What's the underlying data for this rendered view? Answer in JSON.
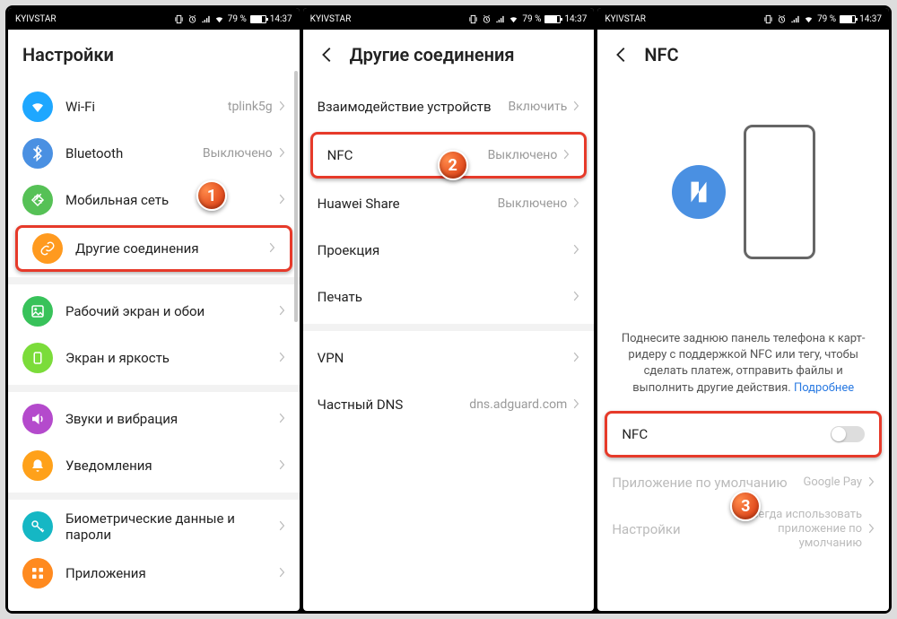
{
  "status": {
    "carrier": "KYIVSTAR",
    "battery": "79 %",
    "time": "14:37"
  },
  "s1": {
    "title": "Настройки",
    "rows": [
      {
        "label": "Wi-Fi",
        "value": "tplink5g",
        "icon": "wifi",
        "color": "#1ea7ff"
      },
      {
        "label": "Bluetooth",
        "value": "Выключено",
        "icon": "bt",
        "color": "#4a90e2"
      },
      {
        "label": "Мобильная сеть",
        "value": "",
        "icon": "sim",
        "color": "#56c156"
      },
      {
        "label": "Другие соединения",
        "value": "",
        "icon": "link",
        "color": "#ff9a1f",
        "hl": true
      },
      {
        "label": "Рабочий экран и обои",
        "value": "",
        "icon": "image",
        "color": "#38c25a"
      },
      {
        "label": "Экран и яркость",
        "value": "",
        "icon": "bright",
        "color": "#7bdc3a"
      },
      {
        "label": "Звуки и вибрация",
        "value": "",
        "icon": "sound",
        "color": "#b44acc"
      },
      {
        "label": "Уведомления",
        "value": "",
        "icon": "bell",
        "color": "#ffa11a"
      },
      {
        "label": "Биометрические данные и пароли",
        "value": "",
        "icon": "key",
        "color": "#15b7c4"
      },
      {
        "label": "Приложения",
        "value": "",
        "icon": "apps",
        "color": "#ff8a1f"
      }
    ],
    "badge": "1"
  },
  "s2": {
    "title": "Другие соединения",
    "rows": [
      {
        "label": "Взаимодействие устройств",
        "value": "Включить"
      },
      {
        "label": "NFC",
        "value": "Выключено",
        "hl": true
      },
      {
        "label": "Huawei Share",
        "value": "Выключено"
      },
      {
        "label": "Проекция",
        "value": ""
      },
      {
        "label": "Печать",
        "value": ""
      },
      {
        "label": "VPN",
        "value": "",
        "group": 2
      },
      {
        "label": "Частный DNS",
        "value": "dns.adguard.com",
        "group": 2
      }
    ],
    "badge": "2"
  },
  "s3": {
    "title": "NFC",
    "desc_pre": "Поднесите заднюю панель телефона к карт-ридеру с поддержкой NFC или тегу, чтобы сделать платеж, отправить файлы и выполнить другие действия. ",
    "desc_link": "Подробнее",
    "rows": [
      {
        "label": "NFC",
        "toggle": true,
        "hl": true
      },
      {
        "label": "Приложение по умолчанию",
        "value": "Google Pay",
        "dim": true
      },
      {
        "label": "Настройки",
        "value": "Всегда использовать приложение по умолчанию",
        "dim": true
      }
    ],
    "badge": "3"
  }
}
